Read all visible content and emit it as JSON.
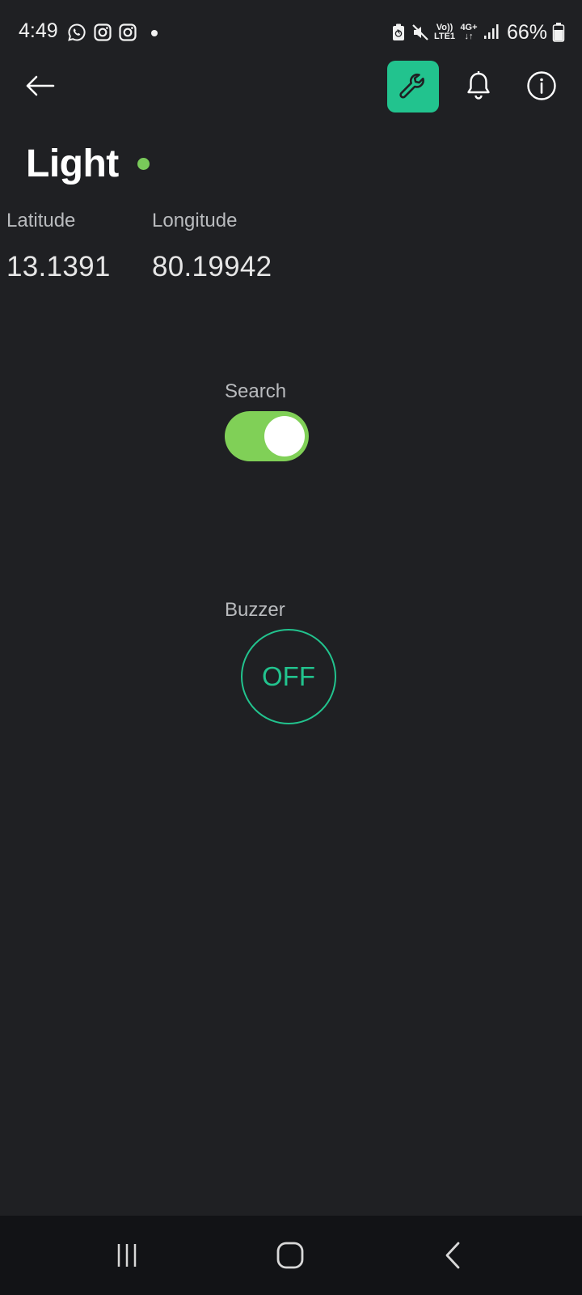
{
  "status_bar": {
    "time": "4:49",
    "battery_percent": "66%",
    "network_volte": "Vo))",
    "network_lte": "LTE1",
    "network_4g": "4G+",
    "icons": [
      "whatsapp-icon",
      "instagram-icon",
      "instagram-icon",
      "notification-dot",
      "battery-saver-icon",
      "mute-icon",
      "signal-icon",
      "battery-icon"
    ]
  },
  "header": {
    "icons": [
      "back-arrow-icon",
      "wrench-icon",
      "bell-icon",
      "info-icon"
    ],
    "accent_color": "#22c38e"
  },
  "device": {
    "title": "Light",
    "status_color": "#79c95a"
  },
  "location": {
    "latitude_label": "Latitude",
    "latitude_value": "13.1391",
    "longitude_label": "Longitude",
    "longitude_value": "80.19942"
  },
  "search": {
    "label": "Search",
    "state": "on",
    "color": "#80d057"
  },
  "buzzer": {
    "label": "Buzzer",
    "button_text": "OFF"
  },
  "nav_bar": {
    "icons": [
      "recent-apps-icon",
      "home-icon",
      "back-icon"
    ]
  }
}
